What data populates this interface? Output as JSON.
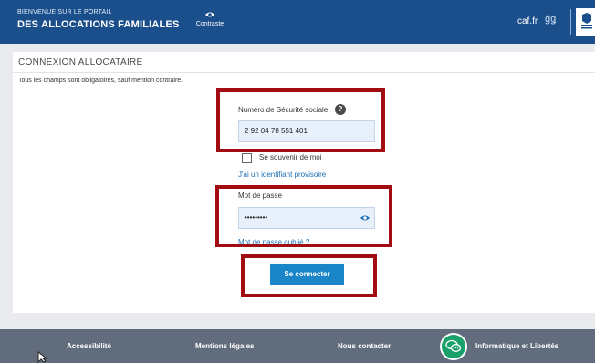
{
  "header": {
    "subtitle": "BIENVENUE SUR LE PORTAIL",
    "title": "DES ALLOCATIONS FAMILIALES",
    "contrast_label": "Contraste",
    "caf_logo_text": "caf.fr",
    "mobile_icon_text": "ǵǥ"
  },
  "page": {
    "section_title": "CONNEXION ALLOCATAIRE",
    "required_note": "Tous les champs sont obligatoires, sauf mention contraire."
  },
  "form": {
    "ssn_label": "Numéro de Sécurité sociale",
    "ssn_value": "2 92 04 78 551 401",
    "remember_label": "Se souvenir de moi",
    "remember_checked": false,
    "temp_id_link": "J'ai un identifiant provisoire",
    "password_label": "Mot de passe",
    "password_value": "•••••••••",
    "forgot_link": "Mot de passe oublié ?",
    "submit_label": "Se connecter"
  },
  "footer": {
    "links": [
      "Accessibilité",
      "Mentions légales",
      "Nous contacter",
      "Informatique et Libertés"
    ]
  },
  "colors": {
    "header_bg": "#1b4f8c",
    "button_bg": "#1a86c7",
    "link": "#1a6db4",
    "highlight": "#a10d12",
    "footer_bg": "#616d7c",
    "chat_bg": "#1aa06a"
  },
  "icons": {
    "contrast": "eye-icon",
    "help": "help-circle-icon",
    "show_password": "eye-icon",
    "chat": "chat-bubble-icon",
    "cursor": "mouse-pointer-icon"
  }
}
